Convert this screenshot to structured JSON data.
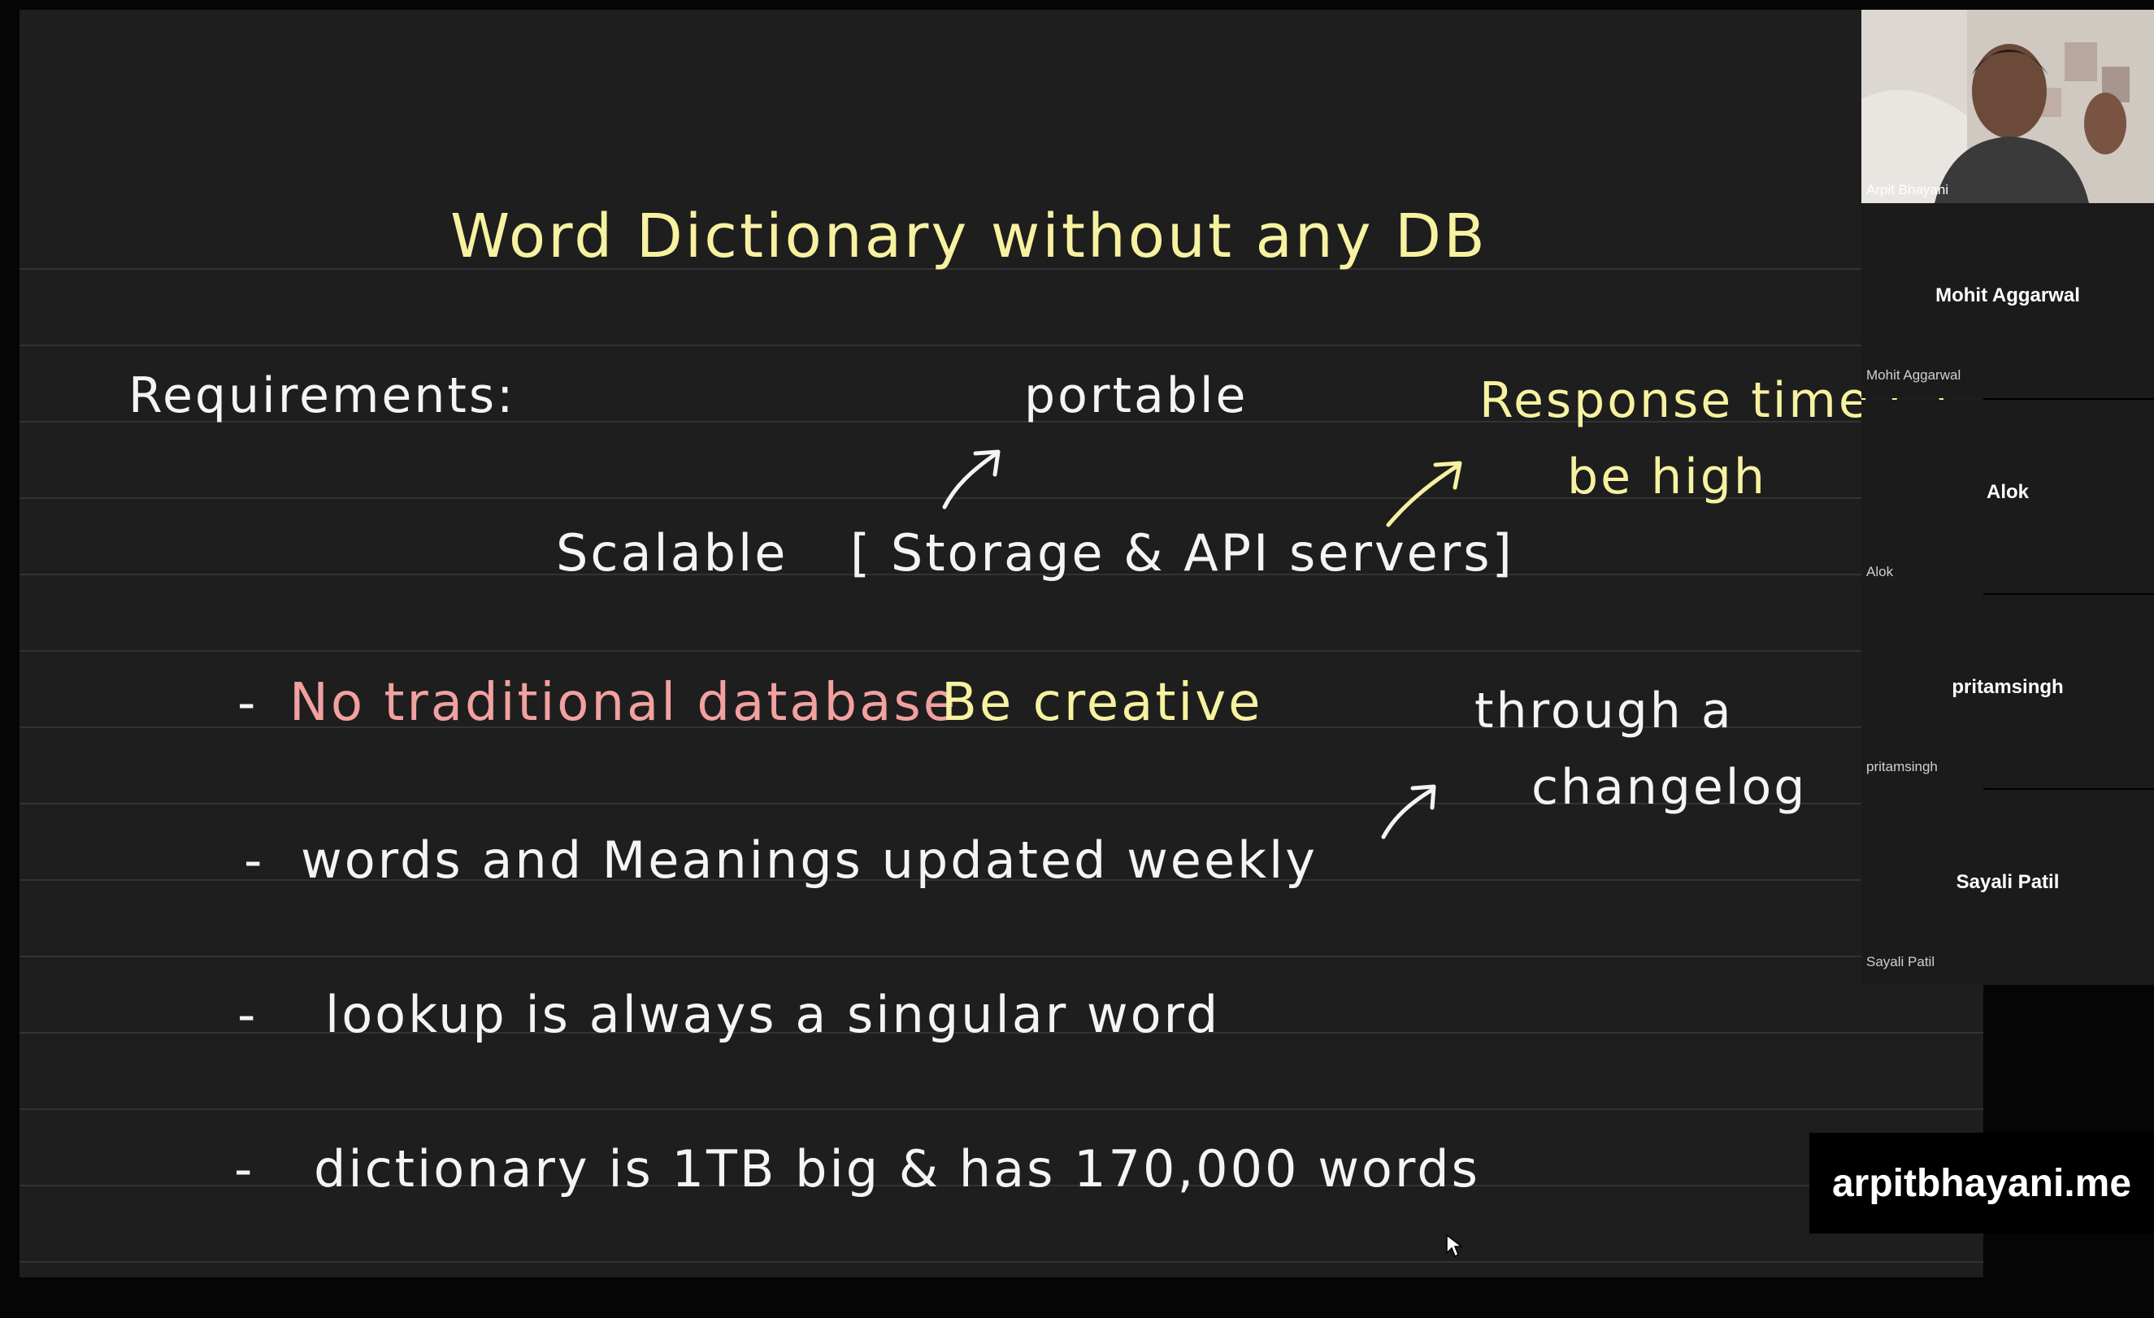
{
  "whiteboard": {
    "title": "Word Dictionary without any DB",
    "requirements_label": "Requirements:",
    "annot_portable": "portable",
    "annot_response_line1": "Response time ca–",
    "annot_response_line2": "be high",
    "scalable_text": "Scalable",
    "scalable_bracket": "[ Storage & API servers]",
    "bullet_dash": "-",
    "bullet1_red": "No traditional database",
    "bullet1_yellow": "Be creative",
    "annot_changelog_line1": "through a",
    "annot_changelog_line2": "changelog",
    "bullet2": "words and Meanings updated weekly",
    "bullet3": "lookup is always a singular word",
    "bullet4": "dictionary is 1TB big & has 170,000 words",
    "colors": {
      "white_ink": "#f4f4f4",
      "yellow_ink": "#f7f2a0",
      "red_ink": "#f2a0a0",
      "board_bg": "#1e1e1e"
    }
  },
  "participants": {
    "host_caption": "Arpit Bhayani",
    "tiles": [
      {
        "name": "Mohit Aggarwal",
        "caption": "Mohit Aggarwal"
      },
      {
        "name": "Alok",
        "caption": "Alok"
      },
      {
        "name": "pritamsingh",
        "caption": "pritamsingh"
      },
      {
        "name": "Sayali Patil",
        "caption": "Sayali Patil"
      }
    ]
  },
  "watermark": "arpitbhayani.me",
  "icons": {
    "cursor": "mouse-pointer-icon",
    "arrow": "hand-drawn-arrow-icon"
  }
}
